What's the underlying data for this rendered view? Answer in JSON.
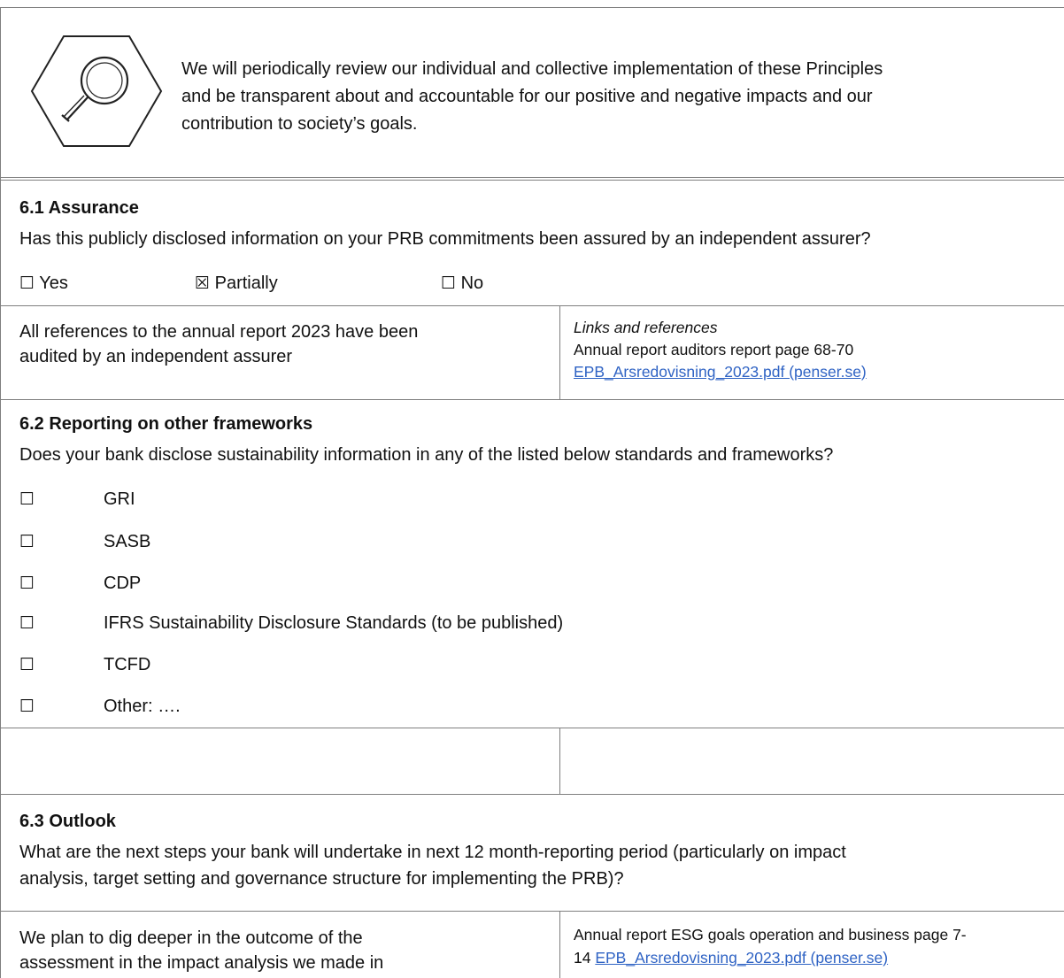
{
  "intro": {
    "icon": "magnifier-hexagon-icon",
    "lines": [
      "We will periodically review our individual and collective implementation of these Principles",
      "and be transparent about and accountable for our positive and negative impacts and our",
      "contribution to society’s goals."
    ]
  },
  "s61": {
    "title": "6.1  Assurance",
    "question": "Has this publicly disclosed information on your PRB commitments been assured by an independent assurer?",
    "options": [
      {
        "box": "☐",
        "label": "Yes"
      },
      {
        "box": "☒",
        "label": "Partially"
      },
      {
        "box": "☐",
        "label": "No"
      }
    ],
    "left_lines": [
      "All references to the annual report 2023 have been",
      "audited by an independent assurer"
    ],
    "right_heading": "Links and references",
    "right_line": "Annual report auditors report page 68-70",
    "right_link": "EPB_Arsredovisning_2023.pdf (penser.se)"
  },
  "s62": {
    "title": "6.2  Reporting on other frameworks",
    "question": "Does your bank disclose sustainability information in any of the listed below standards and frameworks?",
    "items": [
      {
        "box": "☐",
        "label": "GRI"
      },
      {
        "box": "☐",
        "label": "SASB"
      },
      {
        "box": "☐",
        "label": "CDP"
      },
      {
        "box": "☐",
        "label": "IFRS Sustainability Disclosure Standards (to be published)"
      },
      {
        "box": "☐",
        "label": "TCFD"
      },
      {
        "box": "☐",
        "label": "Other: …."
      }
    ]
  },
  "s63": {
    "title": "6.3  Outlook",
    "question_lines": [
      "What are the next steps your bank will undertake in next 12 month-reporting period (particularly on impact",
      "analysis, target setting and governance structure for implementing the PRB)?"
    ],
    "left_lines": [
      "We plan to dig deeper in the outcome of the",
      "assessment in the impact analysis we made in"
    ],
    "right_line1": "Annual report ESG goals operation and business page 7-",
    "right_prefix": "14 ",
    "right_link": "EPB_Arsredovisning_2023.pdf (penser.se)"
  }
}
